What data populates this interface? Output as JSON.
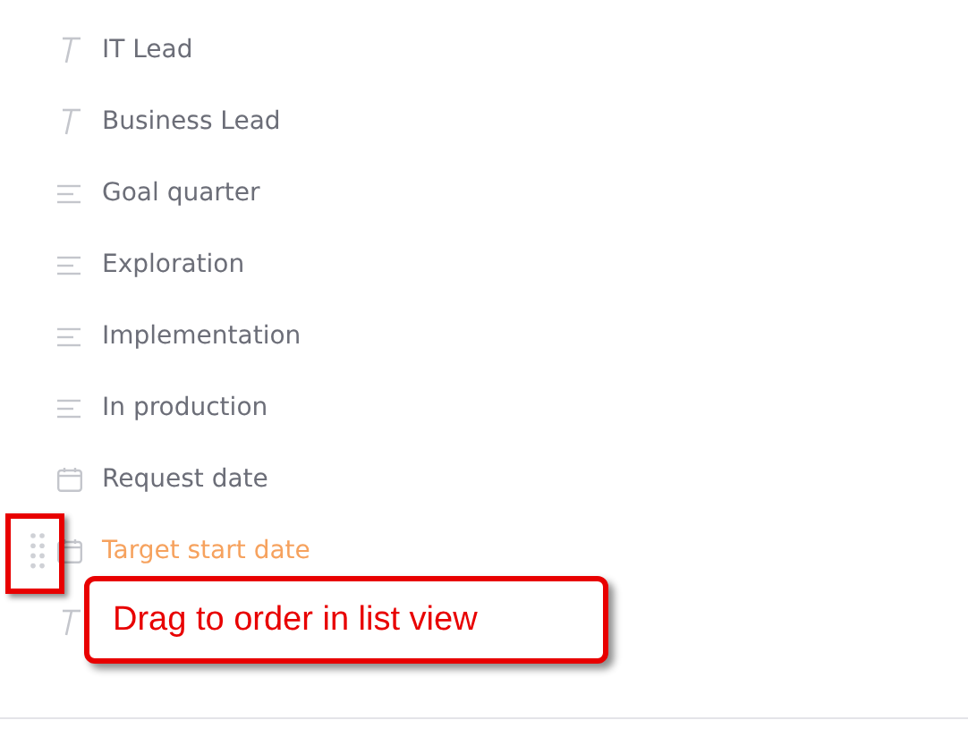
{
  "fields": [
    {
      "kind": "text",
      "label": "IT Lead",
      "hovered": false
    },
    {
      "kind": "text",
      "label": "Business Lead",
      "hovered": false
    },
    {
      "kind": "dropdown",
      "label": "Goal quarter",
      "hovered": false
    },
    {
      "kind": "dropdown",
      "label": "Exploration",
      "hovered": false
    },
    {
      "kind": "dropdown",
      "label": "Implementation",
      "hovered": false
    },
    {
      "kind": "dropdown",
      "label": "In production",
      "hovered": false
    },
    {
      "kind": "date",
      "label": "Request date",
      "hovered": false
    },
    {
      "kind": "date",
      "label": "Target start date",
      "hovered": true
    },
    {
      "kind": "text",
      "hovered": false
    }
  ],
  "callout": {
    "text": "Drag to order in list view"
  }
}
